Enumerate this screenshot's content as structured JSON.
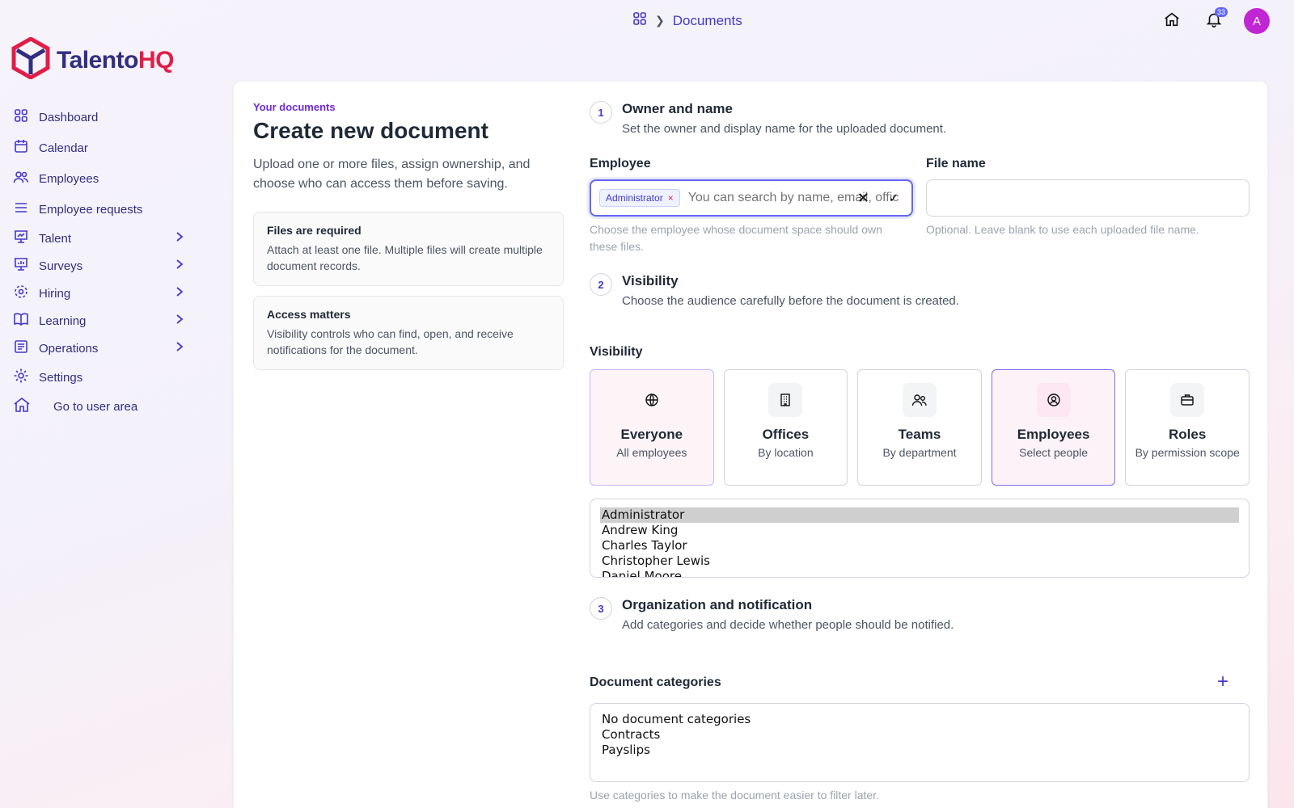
{
  "breadcrumb": {
    "current": "Documents"
  },
  "topbar": {
    "notification_count": "33",
    "avatar_initial": "A"
  },
  "brand": {
    "part1": "Talento",
    "part2": "HQ"
  },
  "sidebar": {
    "items": [
      {
        "label": "Dashboard",
        "icon": "grid-icon"
      },
      {
        "label": "Calendar",
        "icon": "calendar-icon"
      },
      {
        "label": "Employees",
        "icon": "people-icon"
      },
      {
        "label": "Employee requests",
        "icon": "list-icon"
      },
      {
        "label": "Talent",
        "icon": "chart-icon"
      },
      {
        "label": "Surveys",
        "icon": "survey-icon"
      },
      {
        "label": "Hiring",
        "icon": "hiring-icon"
      },
      {
        "label": "Learning",
        "icon": "book-icon"
      },
      {
        "label": "Operations",
        "icon": "operations-icon"
      },
      {
        "label": "Settings",
        "icon": "gear-icon"
      },
      {
        "label": "Go to user area",
        "icon": "home-icon"
      }
    ]
  },
  "page": {
    "eyebrow": "Your documents",
    "title": "Create new document",
    "intro": "Upload one or more files, assign ownership, and choose who can access them before saving.",
    "notes": [
      {
        "title": "Files are required",
        "body": "Attach at least one file. Multiple files will create multiple document records."
      },
      {
        "title": "Access matters",
        "body": "Visibility controls who can find, open, and receive notifications for the document."
      }
    ]
  },
  "steps": [
    {
      "num": "1",
      "title": "Owner and name",
      "desc": "Set the owner and display name for the uploaded document."
    },
    {
      "num": "2",
      "title": "Visibility",
      "desc": "Choose the audience carefully before the document is created."
    },
    {
      "num": "3",
      "title": "Organization and notification",
      "desc": "Add categories and decide whether people should be notified."
    }
  ],
  "employee_field": {
    "label": "Employee",
    "chip": "Administrator",
    "placeholder": "You can search by name, email, offic",
    "hint": "Choose the employee whose document space should own these files."
  },
  "file_name_field": {
    "label": "File name",
    "value": "",
    "hint": "Optional. Leave blank to use each uploaded file name."
  },
  "visibility": {
    "label": "Visibility",
    "options": [
      {
        "title": "Everyone",
        "sub": "All employees"
      },
      {
        "title": "Offices",
        "sub": "By location"
      },
      {
        "title": "Teams",
        "sub": "By department"
      },
      {
        "title": "Employees",
        "sub": "Select people"
      },
      {
        "title": "Roles",
        "sub": "By permission scope"
      }
    ],
    "employees_list": [
      "Administrator",
      "Andrew King",
      "Charles Taylor",
      "Christopher Lewis",
      "Daniel Moore"
    ]
  },
  "categories": {
    "label": "Document categories",
    "options": [
      "No document categories",
      "Contracts",
      "Payslips"
    ],
    "hint": "Use categories to make the document easier to filter later."
  },
  "colors": {
    "accent": "#4338ca",
    "brand_pink": "#e11d48",
    "selected_border": "#7c6df0"
  }
}
